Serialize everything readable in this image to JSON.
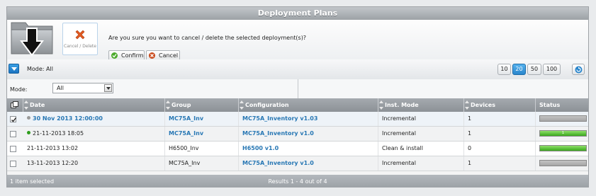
{
  "window": {
    "title": "Deployment Plans"
  },
  "actions": {
    "cancel_tile_label": "Cancel / Delete",
    "question": "Are you sure you want to cancel / delete the selected deployment(s)?",
    "confirm_label": "Confirm",
    "cancel_label": "Cancel"
  },
  "toolbar": {
    "mode_text": "Mode: All",
    "page_sizes": [
      "10",
      "20",
      "50",
      "100"
    ],
    "active_page_size": "20"
  },
  "filter": {
    "mode_label": "Mode:",
    "mode_value": "All"
  },
  "table": {
    "headers": {
      "date": "Date",
      "group": "Group",
      "configuration": "Configuration",
      "inst_mode": "Inst. Mode",
      "devices": "Devices",
      "status": "Status"
    },
    "rows": [
      {
        "checked": true,
        "dot": "grey",
        "date": "30 Nov 2013 12:00:00",
        "group": "MC75A_Inv",
        "configuration": "MC75A_Inventory v1.03",
        "inst_mode": "Incremental",
        "devices": "1",
        "progress": 0,
        "progress_label": "",
        "date_link": true,
        "group_link": true
      },
      {
        "checked": false,
        "dot": "green",
        "date": "21-11-2013 18:05",
        "group": "MC75A_Inv",
        "configuration": "MC75A_Inventory v1.0",
        "inst_mode": "Incremental",
        "devices": "1",
        "progress": 1.0,
        "progress_label": "1",
        "date_link": false,
        "group_link": true
      },
      {
        "checked": false,
        "dot": "",
        "date": "21-11-2013 13:02",
        "group": "H6500_Inv",
        "configuration": "H6500 v1.0",
        "inst_mode": "Clean & install",
        "devices": "0",
        "progress": 1.0,
        "progress_label": "",
        "date_link": false,
        "group_link": false
      },
      {
        "checked": false,
        "dot": "",
        "date": "13-11-2013 12:20",
        "group": "MC75A_Inv",
        "configuration": "MC75A_Inventory v1.0",
        "inst_mode": "Incremental",
        "devices": "1",
        "progress": 0,
        "progress_label": "",
        "date_link": false,
        "group_link": false
      }
    ]
  },
  "footer": {
    "selected_text": "1 item selected",
    "results_text": "Results 1 - 4 out of 4"
  },
  "colors": {
    "link": "#2777b4",
    "progress_green": "#3aa81c",
    "active_page": "#2a86cc",
    "dot_green": "#2e9d1c",
    "dot_grey": "#9a9a9a"
  }
}
